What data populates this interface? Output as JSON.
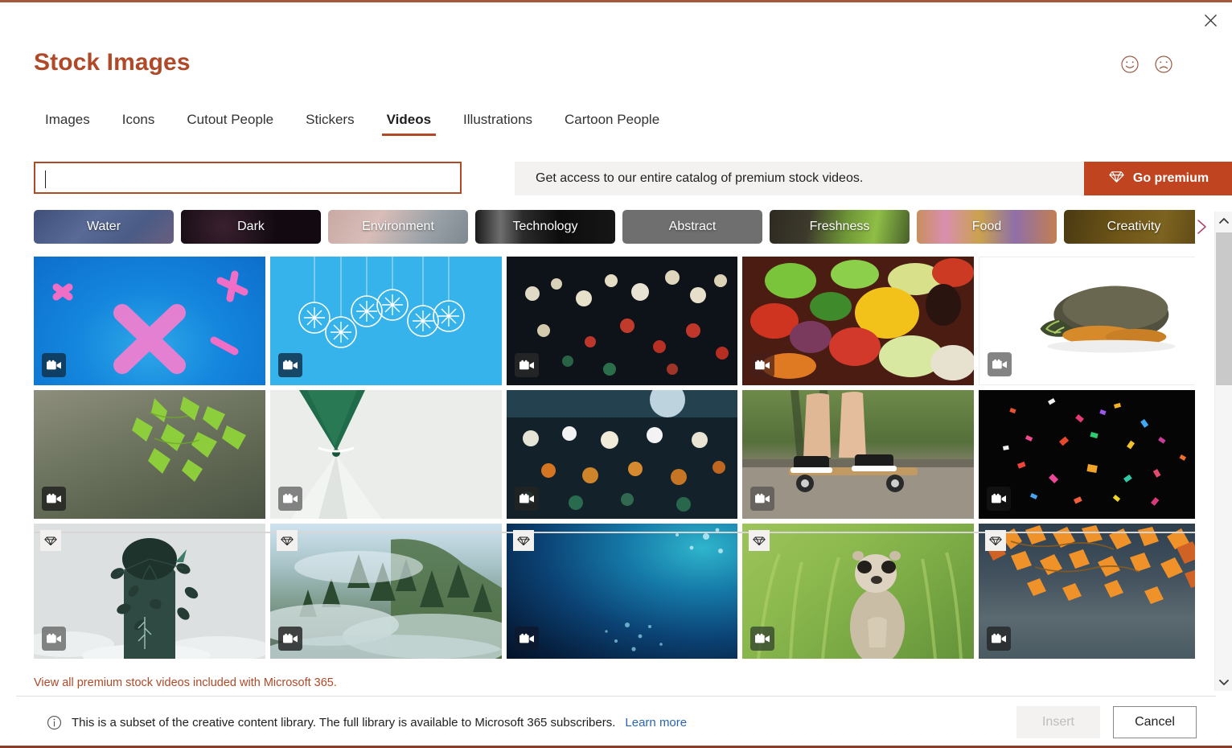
{
  "dialog": {
    "title": "Stock Images",
    "close_label": "Close",
    "accent_color": "#b04928",
    "premium_button_color": "#c0441f"
  },
  "feedback": {
    "happy_label": "Send a smile",
    "sad_label": "Send a frown"
  },
  "tabs": [
    {
      "label": "Images",
      "active": false
    },
    {
      "label": "Icons",
      "active": false
    },
    {
      "label": "Cutout People",
      "active": false
    },
    {
      "label": "Stickers",
      "active": false
    },
    {
      "label": "Videos",
      "active": true
    },
    {
      "label": "Illustrations",
      "active": false
    },
    {
      "label": "Cartoon People",
      "active": false
    }
  ],
  "search": {
    "value": "",
    "placeholder": ""
  },
  "premium_banner": {
    "text": "Get access to our entire catalog of premium stock videos.",
    "button_label": "Go premium",
    "button_icon": "diamond-icon"
  },
  "categories": [
    {
      "label": "Water"
    },
    {
      "label": "Dark"
    },
    {
      "label": "Environment"
    },
    {
      "label": "Technology"
    },
    {
      "label": "Abstract"
    },
    {
      "label": "Freshness"
    },
    {
      "label": "Food"
    },
    {
      "label": "Creativity"
    }
  ],
  "categories_next_icon": "chevron-right-icon",
  "grid": {
    "rows": [
      {
        "premium": false,
        "items": [
          {
            "alt": "pink x shape on blue background",
            "badge": "video-icon",
            "premium": false
          },
          {
            "alt": "white snowflake ornaments on blue background",
            "badge": "video-icon",
            "premium": false
          },
          {
            "alt": "night traffic bokeh lights",
            "badge": "video-icon",
            "premium": false
          },
          {
            "alt": "assorted fresh vegetables",
            "badge": "video-icon",
            "premium": false
          },
          {
            "alt": "turtle on white background",
            "badge": "video-icon",
            "premium": false
          }
        ]
      },
      {
        "premium": false,
        "items": [
          {
            "alt": "green maple leaves over rock",
            "badge": "video-icon",
            "premium": false
          },
          {
            "alt": "green liquid hourglass abstract",
            "badge": "video-icon",
            "premium": false
          },
          {
            "alt": "stadium crowd bokeh at night",
            "badge": "video-icon",
            "premium": false
          },
          {
            "alt": "legs riding a skateboard",
            "badge": "video-icon",
            "premium": false
          },
          {
            "alt": "colorful confetti on black",
            "badge": "video-icon",
            "premium": false
          }
        ]
      },
      {
        "premium": true,
        "items": [
          {
            "alt": "illustrated figure with leaves",
            "badge": "video-icon",
            "premium": true
          },
          {
            "alt": "misty forest mountains",
            "badge": "video-icon",
            "premium": true
          },
          {
            "alt": "deep blue underwater",
            "badge": "video-icon",
            "premium": true
          },
          {
            "alt": "meerkat standing in grass",
            "badge": "video-icon",
            "premium": true
          },
          {
            "alt": "orange autumn maple leaves",
            "badge": "video-icon",
            "premium": true
          }
        ]
      }
    ]
  },
  "view_all_link": "View all premium stock videos included with Microsoft 365.",
  "footer": {
    "info_icon": "info-icon",
    "notice": "This is a subset of the creative content library. The full library is available to Microsoft 365 subscribers.",
    "learn_more": "Learn more",
    "insert_label": "Insert",
    "insert_enabled": false,
    "cancel_label": "Cancel"
  },
  "scrollbar": {
    "up_icon": "chevron-up-icon",
    "down_icon": "chevron-down-icon"
  }
}
